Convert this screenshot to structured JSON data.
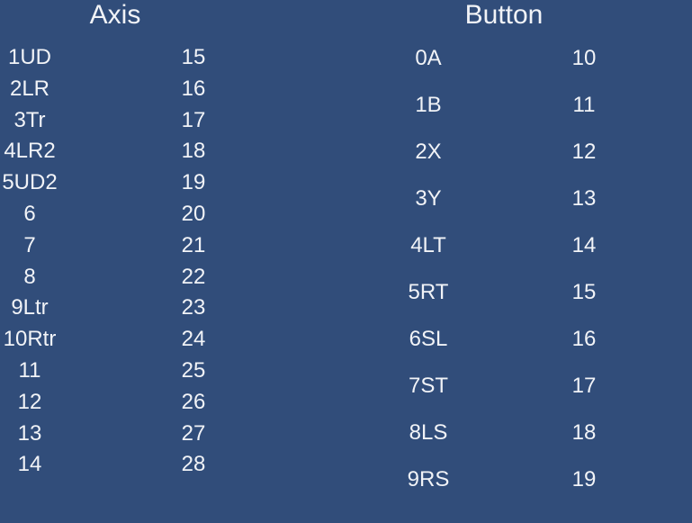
{
  "axis": {
    "title": "Axis",
    "left": [
      "1UD",
      "2LR",
      "3Tr",
      "4LR2",
      "5UD2",
      "6",
      "7",
      "8",
      "9Ltr",
      "10Rtr",
      "11",
      "12",
      "13",
      "14"
    ],
    "right": [
      "15",
      "16",
      "17",
      "18",
      "19",
      "20",
      "21",
      "22",
      "23",
      "24",
      "25",
      "26",
      "27",
      "28"
    ]
  },
  "button": {
    "title": "Button",
    "left": [
      "0A",
      "1B",
      "2X",
      "3Y",
      "4LT",
      "5RT",
      "6SL",
      "7ST",
      "8LS",
      "9RS"
    ],
    "right": [
      "10",
      "11",
      "12",
      "13",
      "14",
      "15",
      "16",
      "17",
      "18",
      "19"
    ]
  },
  "colors": {
    "background": "#314d7a",
    "text": "#f1f3f7"
  }
}
